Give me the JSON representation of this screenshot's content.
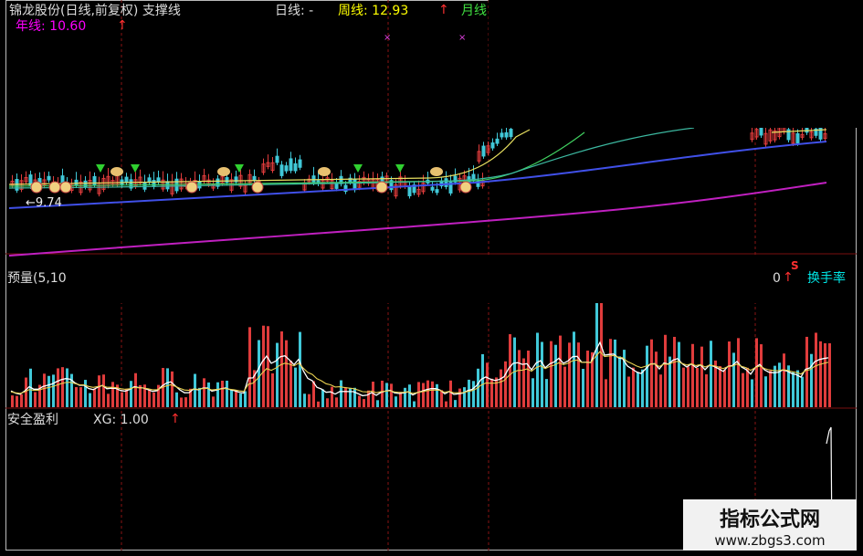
{
  "price_panel": {
    "title": "锦龙股份(日线,前复权) 支撑线",
    "daily_line": "日线: -",
    "weekly_line": "周线: 12.93",
    "monthly_line": "月线",
    "yearly_line": "年线: 10.60",
    "low_marker": "←9.74",
    "up_arrow": "↑"
  },
  "volume_panel": {
    "title": "预量(5,10",
    "turnover": "换手率",
    "s_marker": "S",
    "num_tail": "0",
    "up_arrow": "↑"
  },
  "indicator_panel": {
    "title": "安全盈利",
    "xg_value": "XG: 1.00",
    "up_arrow": "↑"
  },
  "watermark": {
    "title": "指标公式网",
    "url": "www.zbgs3.com"
  },
  "colors": {
    "title": "#dddddd",
    "weekly": "#ffff00",
    "yearly": "#ff00ff",
    "arrow": "#ff3030",
    "turnover": "#00e5e5",
    "up_bar": "#e03c3c",
    "down_bar": "#40c8d8"
  },
  "icons": [
    "up-arrow-icon",
    "down-arrow-icon",
    "buy-signal-icon",
    "sell-signal-icon"
  ]
}
